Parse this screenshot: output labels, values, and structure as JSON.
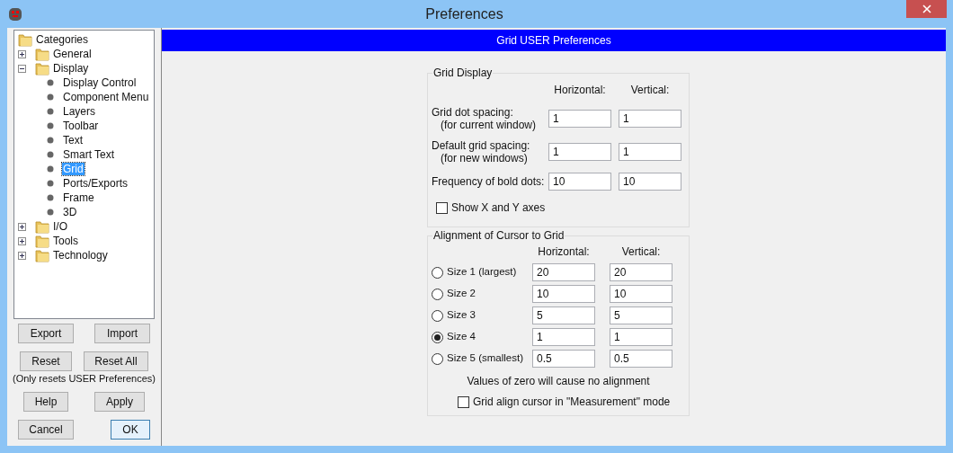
{
  "window": {
    "title": "Preferences"
  },
  "tree": {
    "label": "Categories",
    "kind": "root",
    "children": [
      {
        "label": "General",
        "kind": "folder",
        "expanded": false
      },
      {
        "label": "Display",
        "kind": "folder",
        "expanded": true,
        "children": [
          {
            "label": "Display Control",
            "kind": "leaf",
            "selected": false
          },
          {
            "label": "Component Menu",
            "kind": "leaf",
            "selected": false
          },
          {
            "label": "Layers",
            "kind": "leaf",
            "selected": false
          },
          {
            "label": "Toolbar",
            "kind": "leaf",
            "selected": false
          },
          {
            "label": "Text",
            "kind": "leaf",
            "selected": false
          },
          {
            "label": "Smart Text",
            "kind": "leaf",
            "selected": false
          },
          {
            "label": "Grid",
            "kind": "leaf",
            "selected": true
          },
          {
            "label": "Ports/Exports",
            "kind": "leaf",
            "selected": false
          },
          {
            "label": "Frame",
            "kind": "leaf",
            "selected": false
          },
          {
            "label": "3D",
            "kind": "leaf",
            "selected": false
          }
        ]
      },
      {
        "label": "I/O",
        "kind": "folder",
        "expanded": false
      },
      {
        "label": "Tools",
        "kind": "folder",
        "expanded": false
      },
      {
        "label": "Technology",
        "kind": "folder",
        "expanded": false
      }
    ]
  },
  "left_buttons": {
    "row1": [
      "Export",
      "Import"
    ],
    "row2": [
      "Reset",
      "Reset All"
    ],
    "note": "(Only resets USER Preferences)",
    "row3": [
      "Help",
      "Apply"
    ],
    "row4": [
      {
        "label": "Cancel",
        "default": false
      },
      {
        "label": "OK",
        "default": true
      }
    ]
  },
  "header": "Grid USER Preferences",
  "grid_display": {
    "title": "Grid Display",
    "columns": [
      "Horizontal:",
      "Vertical:"
    ],
    "rows": [
      {
        "label": "Grid dot spacing:",
        "sublabel": "(for current window)",
        "horizontal": "1",
        "vertical": "1"
      },
      {
        "label": "Default grid spacing:",
        "sublabel": "(for new windows)",
        "horizontal": "1",
        "vertical": "1"
      },
      {
        "label": "Frequency of bold dots:",
        "horizontal": "10",
        "vertical": "10"
      }
    ],
    "show_axes": {
      "label": "Show X and Y axes",
      "checked": false
    }
  },
  "alignment": {
    "title": "Alignment of Cursor to Grid",
    "columns": [
      "Horizontal:",
      "Vertical:"
    ],
    "rows": [
      {
        "label": "Size 1 (largest)",
        "selected": false,
        "horizontal": "20",
        "vertical": "20"
      },
      {
        "label": "Size 2",
        "selected": false,
        "horizontal": "10",
        "vertical": "10"
      },
      {
        "label": "Size 3",
        "selected": false,
        "horizontal": "5",
        "vertical": "5"
      },
      {
        "label": "Size 4",
        "selected": true,
        "horizontal": "1",
        "vertical": "1"
      },
      {
        "label": "Size 5 (smallest)",
        "selected": false,
        "horizontal": "0.5",
        "vertical": "0.5"
      }
    ],
    "note": "Values of zero will cause no alignment",
    "measurement": {
      "label": "Grid align cursor in \"Measurement\" mode",
      "checked": false
    }
  }
}
